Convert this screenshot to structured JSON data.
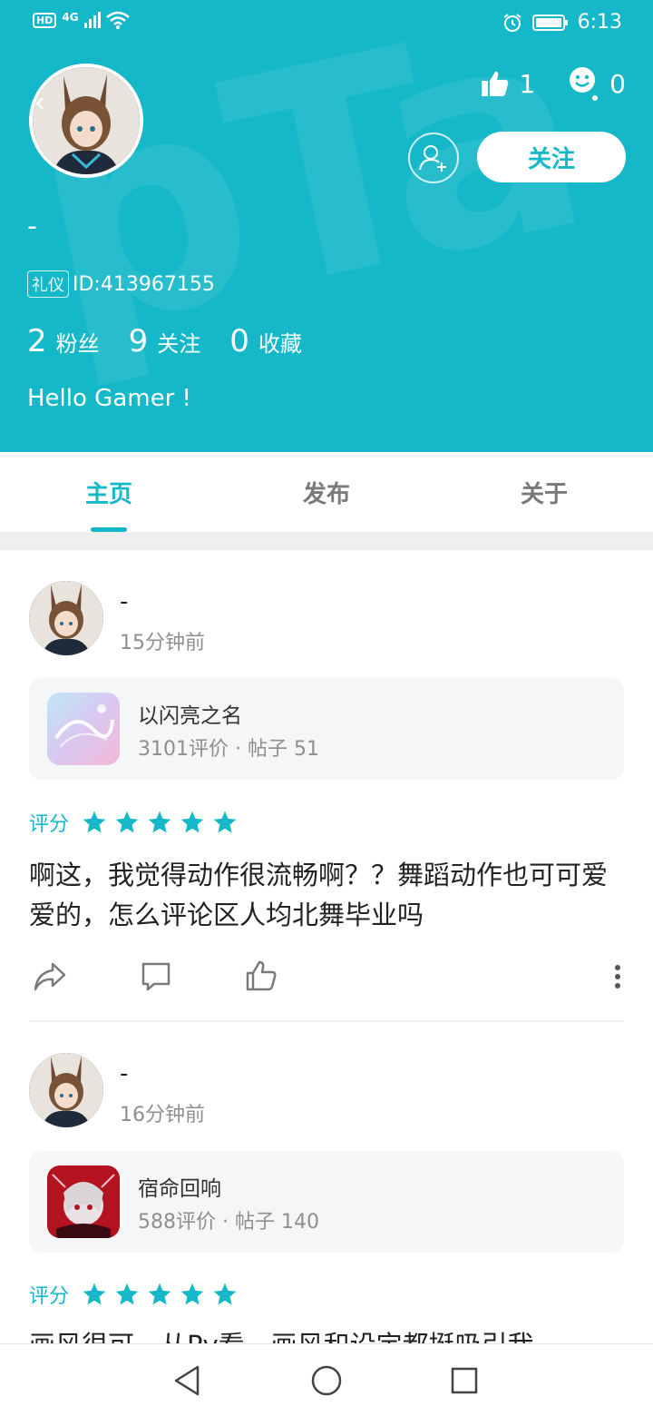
{
  "status_bar": {
    "time": "6:13",
    "hd": "HD",
    "network": "4G"
  },
  "profile": {
    "username": "-",
    "id_tag": "礼仪",
    "id_text": "ID:413967155",
    "likes": "1",
    "reactions": "0",
    "follow_label": "关注",
    "fans_count": "2",
    "fans_label": "粉丝",
    "following_count": "9",
    "following_label": "关注",
    "favorites_count": "0",
    "favorites_label": "收藏",
    "bio": "Hello Gamer !"
  },
  "tabs": [
    {
      "label": "主页",
      "active": true
    },
    {
      "label": "发布",
      "active": false
    },
    {
      "label": "关于",
      "active": false
    }
  ],
  "posts": [
    {
      "author": "-",
      "time": "15分钟前",
      "game_name": "以闪亮之名",
      "game_reviews": "3101评价",
      "game_posts": "帖子 51",
      "rating_label": "评分",
      "stars": 5,
      "text": "啊这，我觉得动作很流畅啊？？舞蹈动作也可可爱爱的，怎么评论区人均北舞毕业吗"
    },
    {
      "author": "-",
      "time": "16分钟前",
      "game_name": "宿命回响",
      "game_reviews": "588评价",
      "game_posts": "帖子 140",
      "rating_label": "评分",
      "stars": 5,
      "text": "画风很可，从Pv看，画风和设定都挺吸引我"
    }
  ],
  "colors": {
    "accent": "#15b8c8",
    "background": "#ffffff"
  },
  "icons": {
    "like": "thumb-up-icon",
    "reaction": "smiley-icon",
    "add_friend": "add-user-icon",
    "share": "share-icon",
    "comment": "comment-icon",
    "post_like": "thumb-up-outline-icon",
    "more": "more-vertical-icon"
  }
}
